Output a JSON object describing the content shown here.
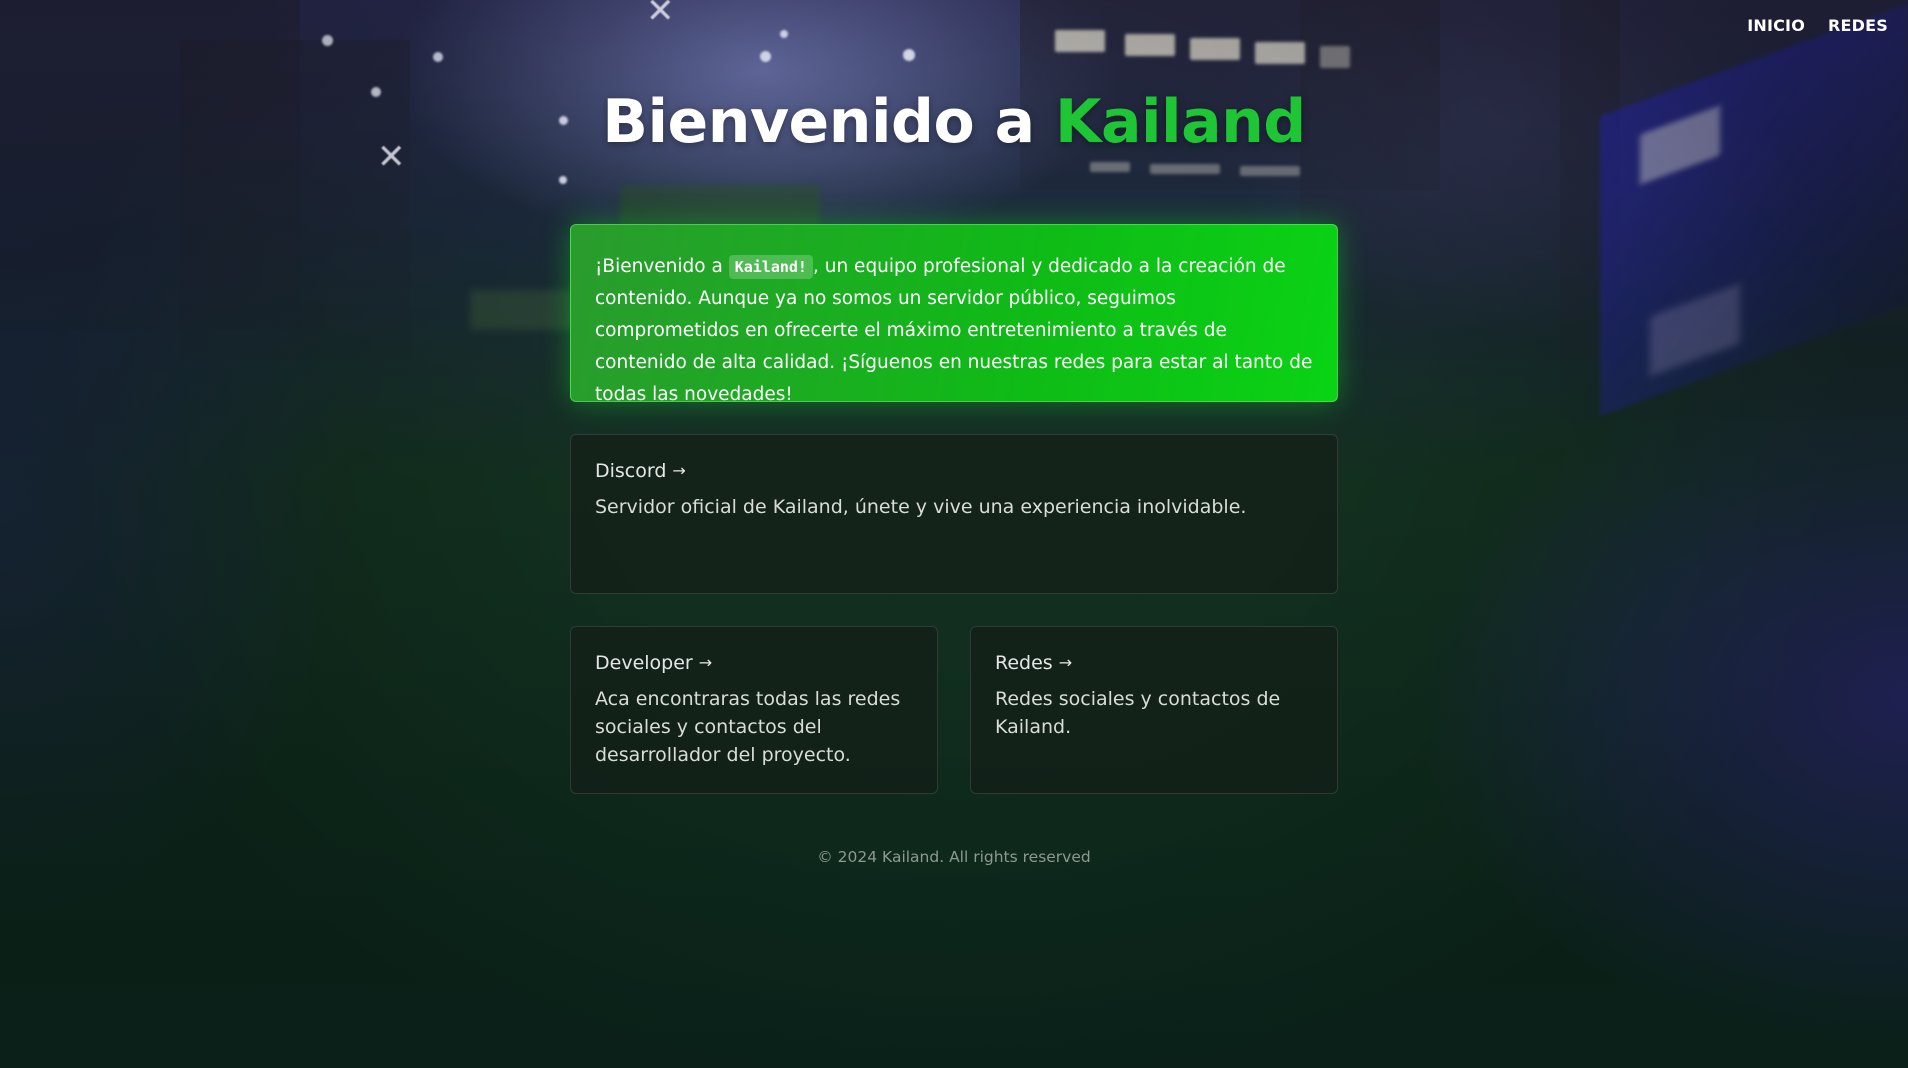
{
  "nav": {
    "items": [
      {
        "label": "INICIO"
      },
      {
        "label": "REDES"
      }
    ]
  },
  "header": {
    "title_prefix": "Bienvenido a ",
    "title_brand": "Kailand"
  },
  "hero": {
    "text_before": "¡Bienvenido a ",
    "code": "Kailand!",
    "text_after": ", un equipo profesional y dedicado a la creación de contenido. Aunque ya no somos un servidor público, seguimos comprometidos en ofrecerte el máximo entretenimiento a través de contenido de alta calidad. ¡Síguenos en nuestras redes para estar al tanto de todas las novedades!"
  },
  "cards": [
    {
      "title": "Discord",
      "description": "Servidor oficial de Kailand, únete y vive una experiencia inolvidable."
    },
    {
      "title": "Developer",
      "description": "Aca encontraras todas las redes sociales y contactos del desarrollador del proyecto."
    },
    {
      "title": "Redes",
      "description": "Redes sociales y contactos de Kailand."
    }
  ],
  "footer": {
    "text": "© 2024 Kailand. All rights reserved"
  },
  "colors": {
    "brand_green": "#1ec635",
    "hero_green": "#0fbb16",
    "card_bg": "#141e18"
  },
  "icons": {
    "card_arrow": "arrow-right-icon"
  }
}
